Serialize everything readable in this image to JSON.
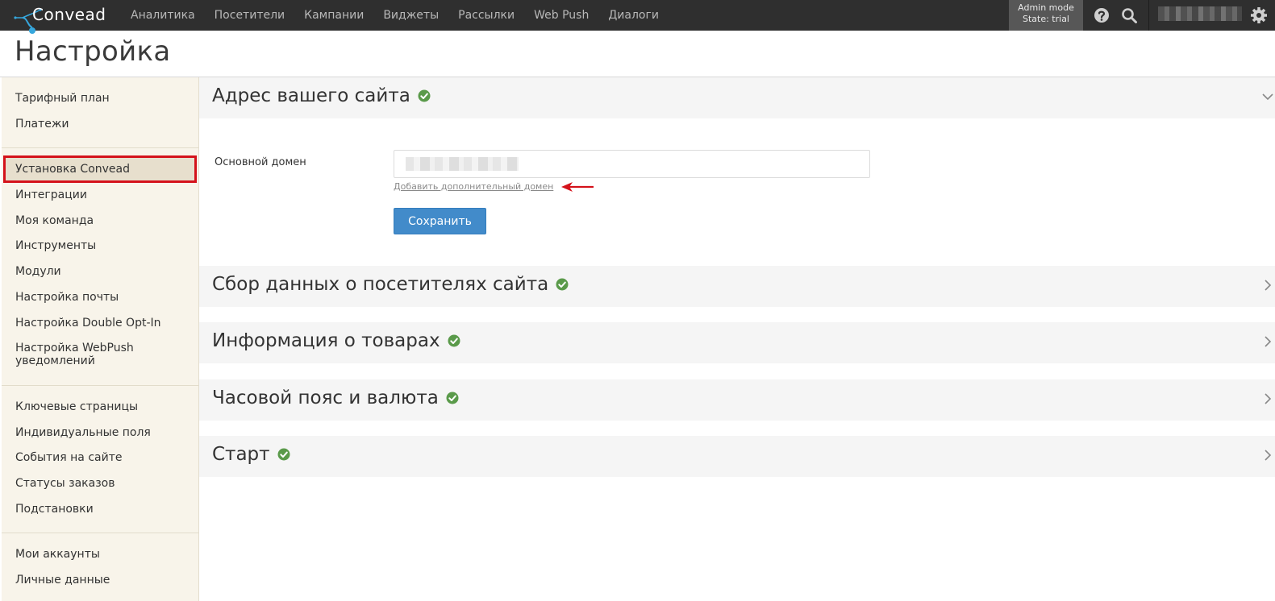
{
  "app": {
    "logo_text": "Convead"
  },
  "nav": {
    "items": [
      "Аналитика",
      "Посетители",
      "Кампании",
      "Виджеты",
      "Рассылки",
      "Web Push",
      "Диалоги"
    ]
  },
  "header": {
    "admin_mode": "Admin mode",
    "state": "State: trial",
    "icons": [
      "help-icon",
      "search-icon",
      "gear-icon"
    ]
  },
  "page": {
    "title": "Настройка"
  },
  "sidebar": {
    "group1": [
      "Тарифный план",
      "Платежи"
    ],
    "group2": [
      "Установка Convead",
      "Интеграции",
      "Моя команда",
      "Инструменты",
      "Модули",
      "Настройка почты",
      "Настройка Double Opt-In",
      "Настройка WebPush уведомлений"
    ],
    "group3": [
      "Ключевые страницы",
      "Индивидуальные поля",
      "События на сайте",
      "Статусы заказов",
      "Подстановки"
    ],
    "group4": [
      "Мои аккаунты",
      "Личные данные"
    ],
    "active": "Установка Convead"
  },
  "sections": [
    {
      "title": "Адрес вашего сайта",
      "expanded": true
    },
    {
      "title": "Сбор данных о посетителях сайта",
      "expanded": false
    },
    {
      "title": "Информация о товарах",
      "expanded": false
    },
    {
      "title": "Часовой пояс и валюта",
      "expanded": false
    },
    {
      "title": "Старт",
      "expanded": false
    }
  ],
  "domain_form": {
    "label": "Основной домен",
    "add_link": "Добавить дополнительный домен",
    "save_label": "Сохранить"
  },
  "colors": {
    "topbar": "#2f2f2f",
    "accent": "#428bca",
    "check": "#5a9a4a",
    "highlight": "#d4121b",
    "sidebar_bg": "#f8f4ea"
  }
}
